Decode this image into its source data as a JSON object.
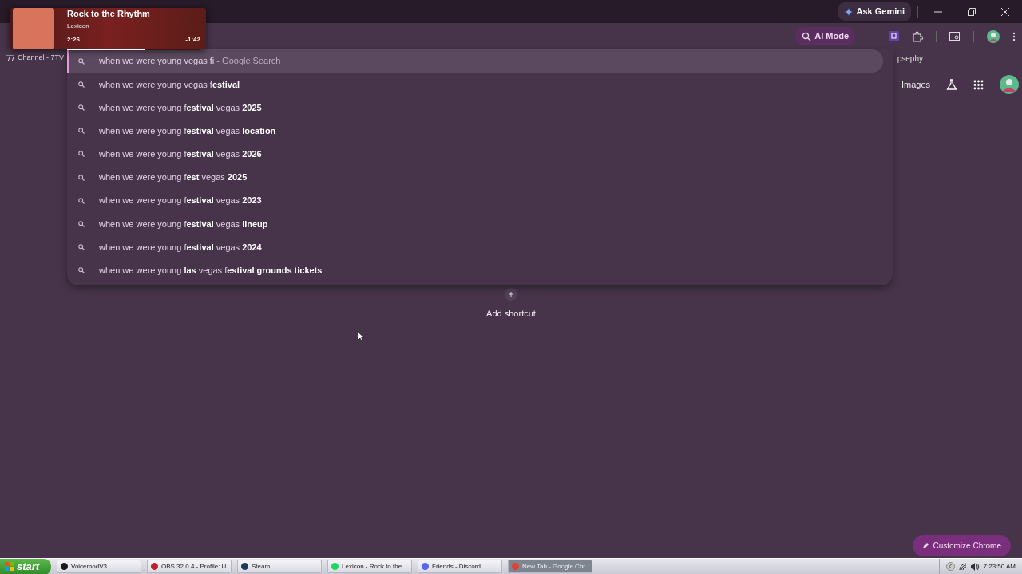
{
  "title_bar": {
    "ask_gemini": "Ask Gemini"
  },
  "toolbar": {
    "ai_mode": "AI Mode"
  },
  "bookmarks": [
    {
      "label": "Channel - 7TV"
    },
    {
      "label": "psephy"
    }
  ],
  "omnibox": {
    "value": "when we were young vegas fi",
    "hint": " - Google Search",
    "suggestions": [
      {
        "text": "when we were young vegas f**estival**"
      },
      {
        "text": "when we were young f**estival** vegas **2025**"
      },
      {
        "text": "when we were young f**estival** vegas **location**"
      },
      {
        "text": "when we were young f**estival** vegas **2026**"
      },
      {
        "text": "when we were young f**est** vegas **2025**"
      },
      {
        "text": "when we were young f**estival** vegas **2023**"
      },
      {
        "text": "when we were young f**estival** vegas **lineup**"
      },
      {
        "text": "when we were young f**estival** vegas **2024**"
      },
      {
        "text": "when we were young **las** vegas f**estival grounds tickets**"
      }
    ]
  },
  "page": {
    "images_link": "Images",
    "add_shortcut": "Add shortcut",
    "customize_button": "Customize Chrome"
  },
  "media_overlay": {
    "title": "Rock to the Rhythm",
    "artist": "Lexicon",
    "elapsed": "2:26",
    "remaining": "-1:42",
    "level": 0.58
  },
  "taskbar": {
    "start": "start",
    "items": [
      {
        "label": "VoicemodV3",
        "color": "#1a1a1a",
        "selected": false
      },
      {
        "label": "OBS 32.0.4 - Profile: U...",
        "color": "#c0202a",
        "selected": false
      },
      {
        "label": "Steam",
        "color": "#1b3a5c",
        "selected": false
      },
      {
        "label": "Lexicon - Rock to the...",
        "color": "#1ed760",
        "selected": false
      },
      {
        "label": "Friends - Discord",
        "color": "#5865f2",
        "selected": false
      },
      {
        "label": "New Tab - Google Chr...",
        "color": "#db4437",
        "selected": true
      }
    ],
    "clock": "7:23:50 AM"
  }
}
